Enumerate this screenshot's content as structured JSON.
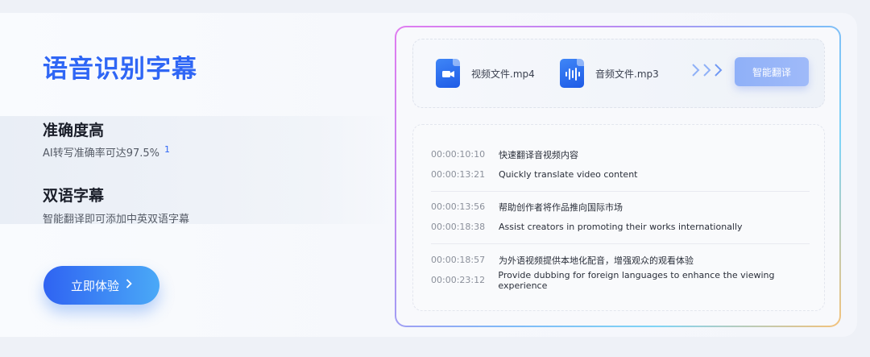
{
  "hero": {
    "title": "语音识别字幕",
    "features": [
      {
        "title": "准确度高",
        "desc": "AI转写准确率可达97.5%",
        "note": "1"
      },
      {
        "title": "双语字幕",
        "desc": "智能翻译即可添加中英双语字幕"
      }
    ],
    "cta_label": "立即体验",
    "cta_icon": "chevron-right-icon"
  },
  "panel": {
    "files": [
      {
        "name": "视频文件.mp4",
        "icon": "video-file-icon"
      },
      {
        "name": "音频文件.mp3",
        "icon": "audio-file-icon"
      }
    ],
    "arrows": "›››",
    "translate_label": "智能翻译",
    "subtitles": [
      {
        "lines": [
          {
            "time": "00:00:10:10",
            "text": "快速翻译音视频内容"
          },
          {
            "time": "00:00:13:21",
            "text": "Quickly translate video content"
          }
        ]
      },
      {
        "lines": [
          {
            "time": "00:00:13:56",
            "text": "帮助创作者将作品推向国际市场"
          },
          {
            "time": "00:00:18:38",
            "text": "Assist creators in promoting their works internationally"
          }
        ]
      },
      {
        "lines": [
          {
            "time": "00:00:18:57",
            "text": "为外语视频提供本地化配音，增强观众的观看体验"
          },
          {
            "time": "00:00:23:12",
            "text": "Provide dubbing for foreign languages to enhance the viewing experience"
          }
        ]
      }
    ]
  },
  "colors": {
    "accent": "#2f66f5",
    "button_start": "#2f63f2",
    "button_end": "#4aa9f7"
  }
}
